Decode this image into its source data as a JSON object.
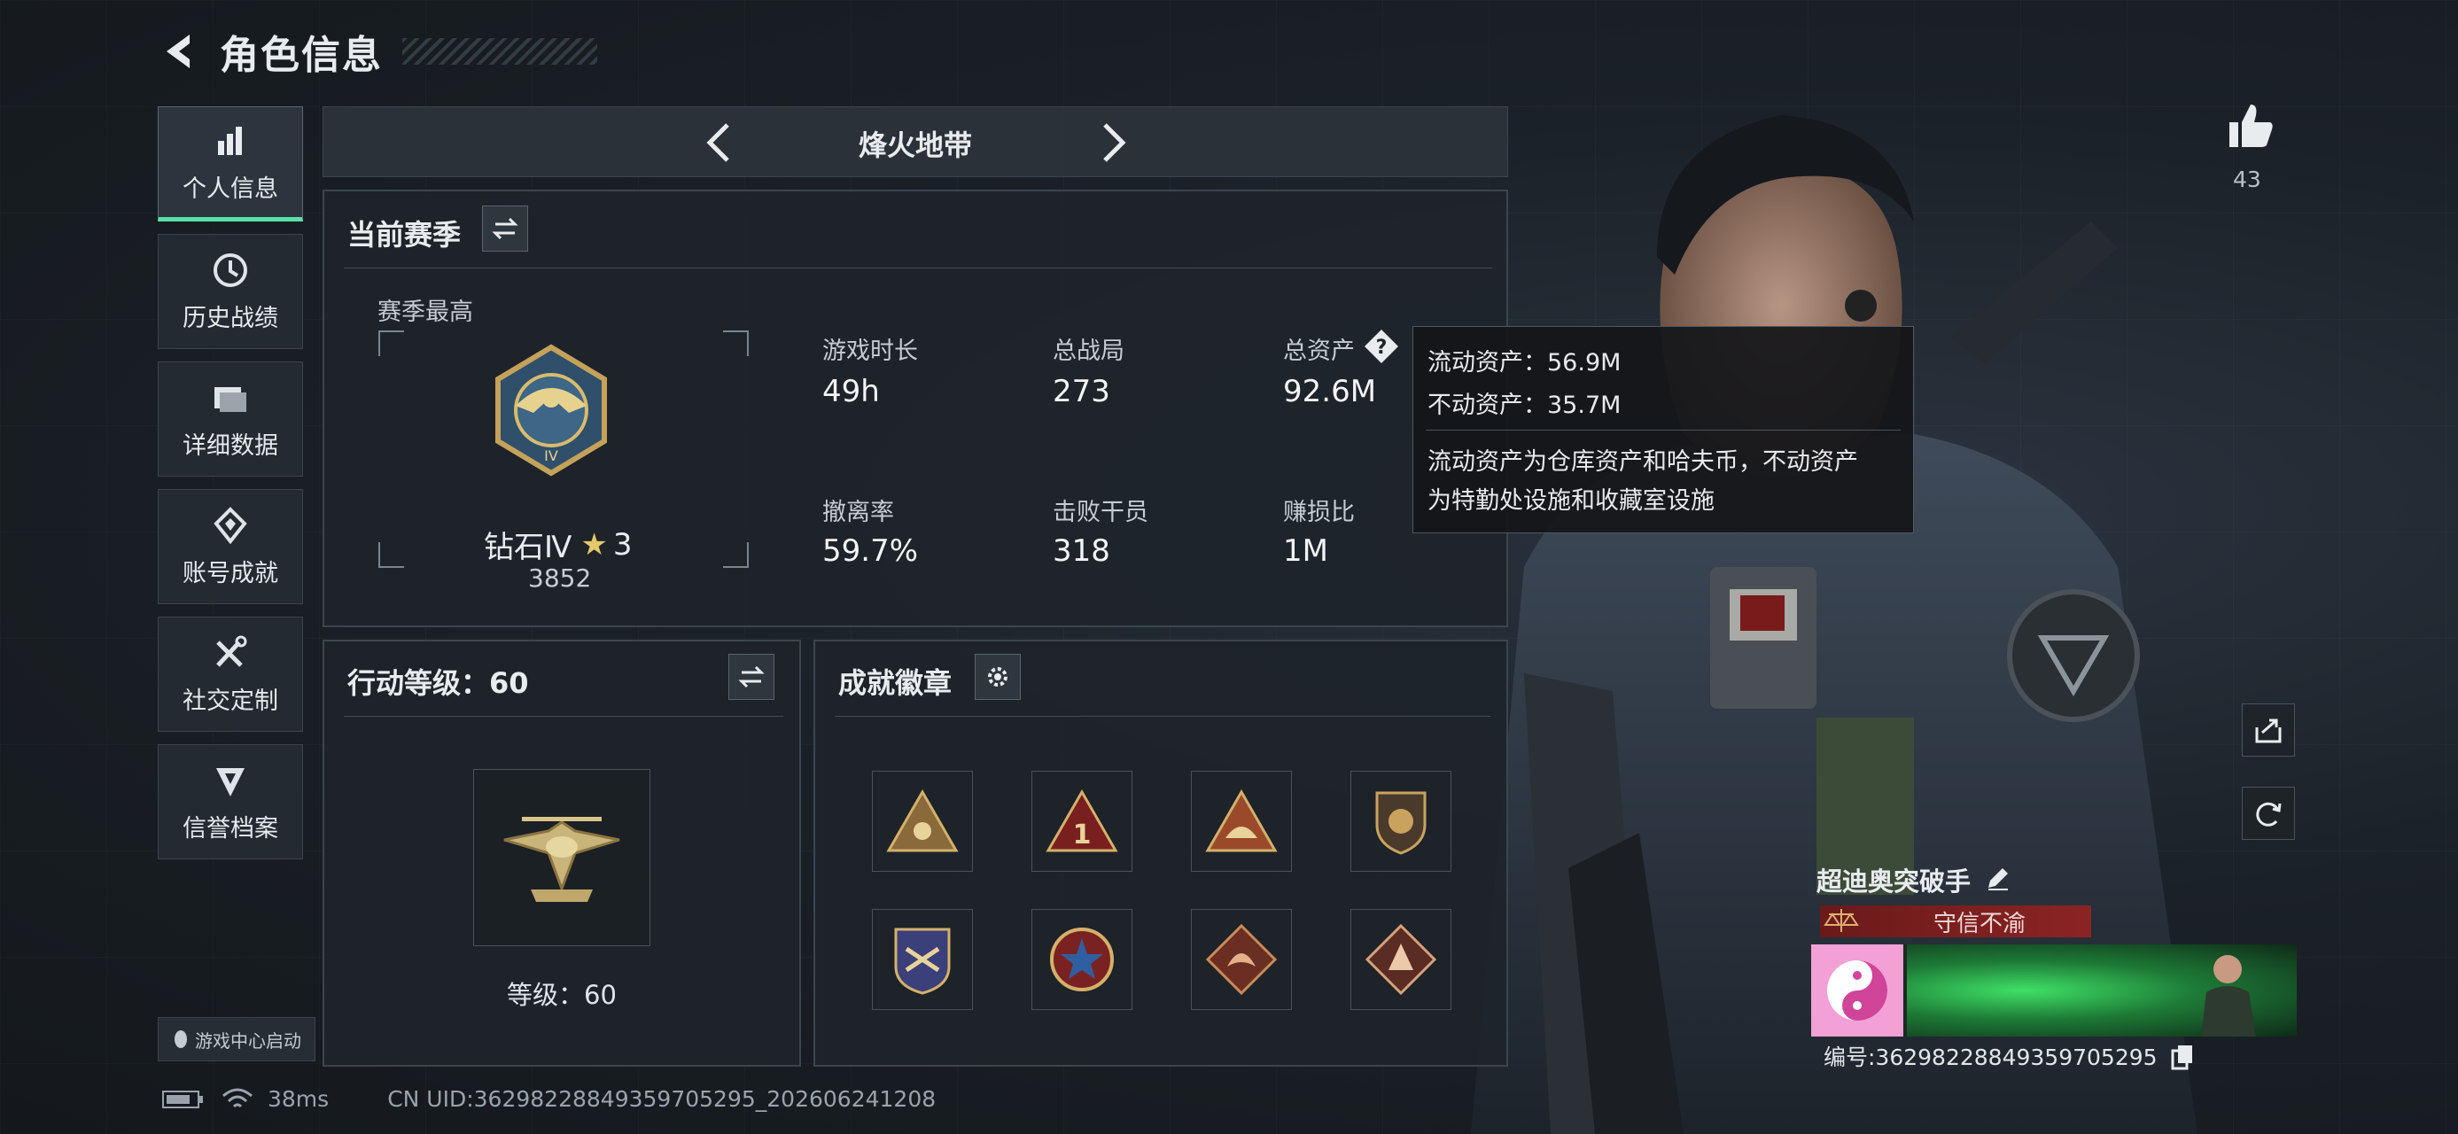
{
  "header": {
    "title": "角色信息"
  },
  "sidebar": {
    "items": [
      {
        "label": "个人信息",
        "icon": "bar-chart-icon",
        "active": true
      },
      {
        "label": "历史战绩",
        "icon": "clock-icon"
      },
      {
        "label": "详细数据",
        "icon": "folder-icon"
      },
      {
        "label": "账号成就",
        "icon": "achievement-icon"
      },
      {
        "label": "社交定制",
        "icon": "tools-icon"
      },
      {
        "label": "信誉档案",
        "icon": "credit-shield-icon"
      }
    ],
    "launch_label": "游戏中心启动"
  },
  "mode": {
    "title": "烽火地带"
  },
  "season": {
    "title": "当前赛季",
    "best_label": "赛季最高",
    "rank_name": "钻石Ⅳ",
    "rank_stars": "3",
    "rank_score": "3852",
    "stats": [
      {
        "label": "游戏时长",
        "value": "49h"
      },
      {
        "label": "总战局",
        "value": "273"
      },
      {
        "label": "总资产",
        "value": "92.6M"
      },
      {
        "label": "撤离率",
        "value": "59.7%"
      },
      {
        "label": "击败干员",
        "value": "318"
      },
      {
        "label": "赚损比",
        "value": "1M"
      }
    ]
  },
  "tooltip": {
    "line1": "流动资产：56.9M",
    "line2": "不动资产：35.7M",
    "line3": "流动资产为仓库资产和哈夫币，不动资产",
    "line4": "为特勤处设施和收藏室设施"
  },
  "action_level": {
    "title": "行动等级：60",
    "level_label": "等级：60"
  },
  "badges": {
    "title": "成就徽章"
  },
  "likes": {
    "count": "43"
  },
  "card": {
    "name": "超迪奥突破手",
    "title": "守信不渝",
    "id": "编号:3629822884935970529​5"
  },
  "status": {
    "ping": "38ms",
    "uid": "CN UID:36298228849359705295_202606241208"
  },
  "colors": {
    "accent": "#58e0a8",
    "title_red": "#8b2424"
  }
}
